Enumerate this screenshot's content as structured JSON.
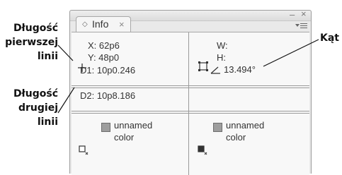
{
  "callouts": {
    "first_line_length": [
      "Długość",
      "pierwszej",
      "linii"
    ],
    "second_line_length": [
      "Długość",
      "drugiej",
      "linii"
    ],
    "angle": "Kąt"
  },
  "panel": {
    "tab_label": "Info",
    "tab_close": "×",
    "window_min": "–",
    "window_close": "×"
  },
  "info": {
    "x": "X: 62p6",
    "y": "Y: 48p0",
    "d1": "D1: 10p0.246",
    "w": "W:",
    "h": "H:",
    "angle": "13.494°",
    "d2": "D2: 10p8.186",
    "fill_color_lines": [
      "unnamed",
      "color"
    ],
    "stroke_color_lines": [
      "unnamed",
      "color"
    ]
  },
  "colors": {
    "panel_bg": "#e9e9e9",
    "content_bg": "#f8f8f8",
    "divider": "#9a9a9a",
    "swatch": "#9e9e9e"
  },
  "icons": [
    "crosshair-icon",
    "bounding-box-icon",
    "angle-icon",
    "fill-proxy-icon",
    "stroke-proxy-icon",
    "panel-menu-icon",
    "tab-diamond-icon"
  ]
}
